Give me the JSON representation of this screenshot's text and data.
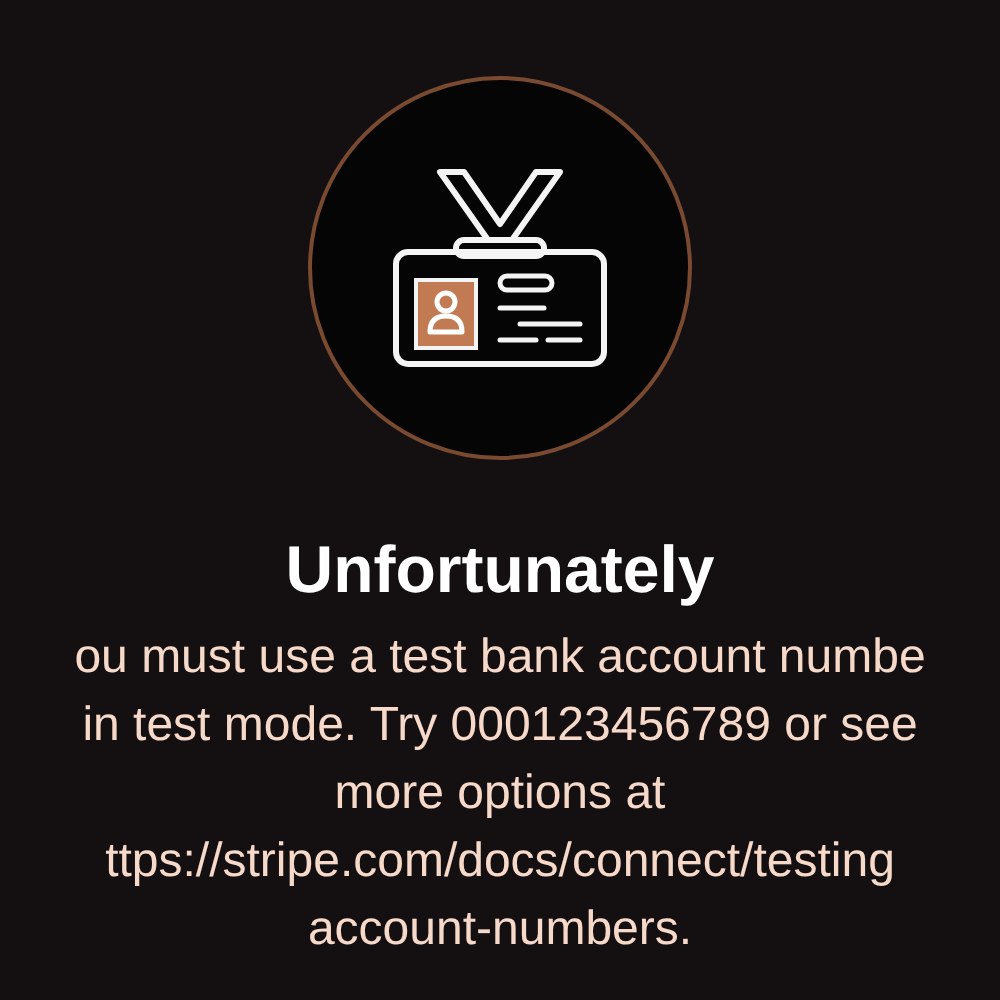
{
  "title": "Unfortunately",
  "message_lines": [
    "ou must use a test bank account numbe",
    "in test mode. Try 000123456789 or see",
    "more options at",
    "ttps://stripe.com/docs/connect/testing",
    "account-numbers."
  ]
}
